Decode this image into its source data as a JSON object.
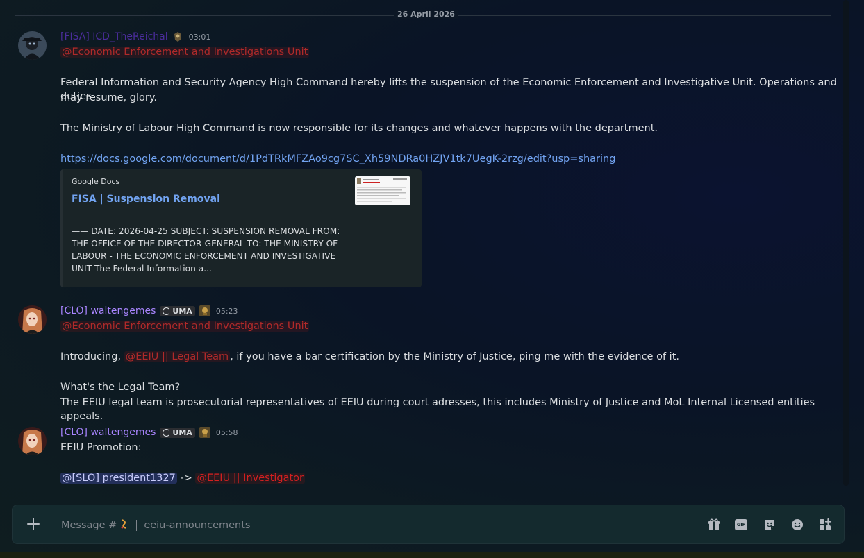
{
  "date_divider": "26 April 2026",
  "messages": [
    {
      "author": "[FISA] ICD_TheReichal",
      "time": "03:01",
      "role_mention": "@Economic Enforcement and Investigations Unit",
      "paragraph1": "Federal Information and Security Agency High Command hereby lifts the suspension of the Economic Enforcement and Investigative Unit. Operations and duties",
      "paragraph1b": "may resume, glory.",
      "paragraph2": "The Ministry of Labour High Command is now responsible for its changes and whatever happens with the department.",
      "link": "https://docs.google.com/document/d/1PdTRkMFZAo9cg7SC_Xh59NDRa0HZJV1tk7UegK-2rzg/edit?usp=sharing",
      "embed": {
        "provider": "Google Docs",
        "title": "FISA | Suspension Removal",
        "rule": "________________________________________________",
        "desc": "—— DATE: 2026-04-25 SUBJECT: SUSPENSION REMOVAL FROM: THE OFFICE OF THE DIRECTOR-GENERAL TO: THE MINISTRY OF LABOUR - THE ECONOMIC ENFORCEMENT AND INVESTIGATIVE UNIT The Federal Information a..."
      }
    },
    {
      "author": "[CLO] waltengemes",
      "tag": "UMA",
      "time": "05:23",
      "role_mention": "@Economic Enforcement and Investigations Unit",
      "intro_prefix": "Introducing, ",
      "intro_mention": "@EEIU || Legal Team",
      "intro_suffix": ", if you have a bar certification by the Ministry of Justice, ping me with the evidence of it.",
      "question": "What's the Legal Team?",
      "answer": "The EEIU legal team is prosecutorial representatives of EEIU during court adresses, this includes Ministry of Justice and MoL Internal Licensed entities appeals."
    },
    {
      "author": "[CLO] waltengemes",
      "tag": "UMA",
      "time": "05:58",
      "line1": "EEIU Promotion:",
      "user_mention": "@[SLO] president1327",
      "arrow": " -> ",
      "role_mention": "@EEIU || Investigator"
    }
  ],
  "composer": {
    "placeholder_prefix": "Message #",
    "channel": "eeiu-announcements",
    "icons": [
      "plus-icon",
      "gift-icon",
      "gif-icon",
      "sticker-icon",
      "emoji-icon",
      "apps-icon"
    ],
    "gif_label": "GIF"
  },
  "colors": {
    "author1": "#4b2d9c",
    "author2": "#a985ff",
    "role_red": "#b02a2a",
    "link": "#72a4f2"
  }
}
